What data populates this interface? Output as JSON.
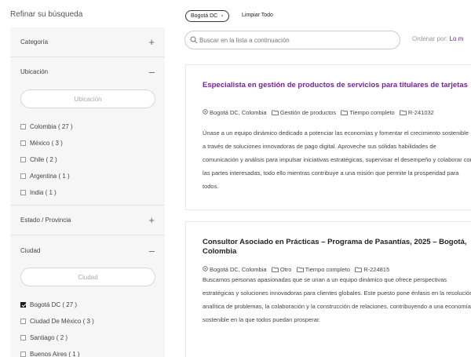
{
  "sidebar": {
    "title": "Refinar su búsqueda",
    "sections": {
      "categoria": {
        "label": "Categoría",
        "toggle": "+"
      },
      "ubicacion": {
        "label": "Ubicación",
        "toggle": "–",
        "placeholder": "Ubicación",
        "options": [
          {
            "label": "Colombia ( 27 )",
            "checked": false
          },
          {
            "label": "México ( 3 )",
            "checked": false
          },
          {
            "label": "Chile ( 2 )",
            "checked": false
          },
          {
            "label": "Argentina ( 1 )",
            "checked": false
          },
          {
            "label": "India ( 1 )",
            "checked": false
          }
        ]
      },
      "estado": {
        "label": "Estado / Provincia",
        "toggle": "+"
      },
      "ciudad": {
        "label": "Ciudad",
        "toggle": "–",
        "placeholder": "Ciudad",
        "options": [
          {
            "label": "Bogotá DC ( 27 )",
            "checked": true
          },
          {
            "label": "Ciudad De México ( 3 )",
            "checked": false
          },
          {
            "label": "Santiago ( 2 )",
            "checked": false
          },
          {
            "label": "Buenos Aires ( 1 )",
            "checked": false
          }
        ]
      }
    }
  },
  "filters": {
    "active_chip": "Bogotá DC",
    "chip_remove": "×",
    "clear_all": "Limpiar Todo"
  },
  "search": {
    "placeholder": "Buscar en la lista a continuación"
  },
  "sort": {
    "label": "Ordenar por:",
    "value": "Lo m"
  },
  "jobs": [
    {
      "title": "Especialista en gestión de productos de servicios para titulares de tarjetas",
      "location": "Bogotá DC, Colombia",
      "category": "Gestión de productos",
      "type": "Tiempo completo",
      "id": "R-241032",
      "description": "Únase a un equipo dinámico dedicado a potenciar las economías y fomentar el crecimiento sostenible a través de soluciones innovadoras de pago digital. Aproveche sus sólidas habilidades de comunicación y análisis para impulsar iniciativas estratégicas, supervisar el desempeño y colaborar con las partes interesadas, todo ello mientras contribuye a una misión que permite la prosperidad para todos."
    },
    {
      "title": "Consultor Asociado en Prácticas – Programa de Pasantías, 2025 – Bogotá, Colombia",
      "location": "Bogotá DC, Colombia",
      "category": "Otro",
      "type": "Tiempo completo",
      "id": "R-224815",
      "description": "Buscamos personas apasionadas que se unan a un equipo dinámico que ofrece perspectivas estratégicas y soluciones innovadoras para clientes globales. Este puesto pone énfasis en la resolución analítica de problemas, la colaboración y la construcción de relaciones, contribuyendo a una economía sostenible en la que todos puedan prosperar."
    }
  ],
  "colors": {
    "accent": "#7a1fa2",
    "panel_bg": "#f6f6f6",
    "checked": "#1c1c1c"
  }
}
